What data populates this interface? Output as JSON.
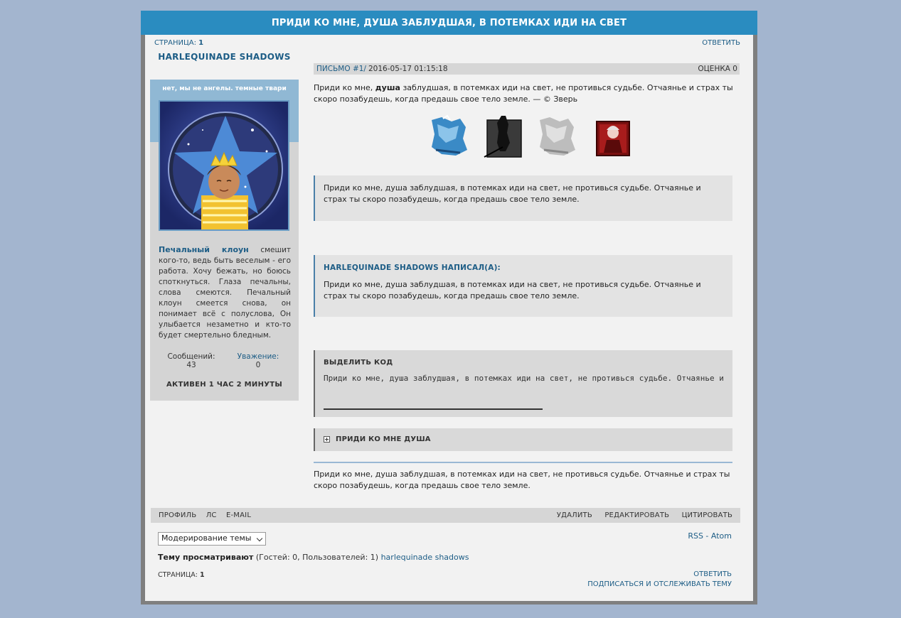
{
  "topic": {
    "title": "ПРИДИ КО МНЕ, ДУША ЗАБЛУДШАЯ, В ПОТЕМКАХ ИДИ НА СВЕТ"
  },
  "pagination": {
    "label": "СТРАНИЦА:",
    "current": "1"
  },
  "actions": {
    "reply": "ОТВЕТИТЬ",
    "subscribe": "ПОДПИСАТЬСЯ И ОТСЛЕЖИВАТЬ ТЕМУ"
  },
  "author": {
    "name": "HARLEQUINADE SHADOWS",
    "status": "нет, мы не ангелы. темные твари",
    "desc_bold": "Печальный клоун",
    "desc_rest": "смешит кого-то, ведь быть веселым - его работа. Хочу бежать, но боюсь споткнуться. Глаза печальны, слова смеются. Печальный клоун смеется снова, он понимает всё с полуслова, Он улыбается незаметно и кто-то будет смертельно бледным.",
    "messages_label": "Сообщений:",
    "messages_value": "43",
    "respect_label": "Уважение:",
    "respect_value": "0",
    "activity": "АКТИВЕН 1 ЧАС 2 МИНУТЫ"
  },
  "post": {
    "number": "ПИСЬМО #1/",
    "date": "2016-05-17 01:15:18",
    "rating": "ОЦЕНКА 0",
    "intro_a": "Приди ко мне, ",
    "intro_bold": "душа",
    "intro_b": " заблудшая, в потемках иди на свет, не противься судьбе. Отчаянье и страх ты скоро позабудешь, когда предашь свое тело земле. — © Зверь",
    "block_text": "Приди ко мне, душа заблудшая, в потемках иди на свет, не противься судьбе. Отчаянье и страх ты скоро позабудешь, когда предашь свое тело земле.",
    "quote_author": "HARLEQUINADE SHADOWS НАПИСАЛ(А):",
    "quote_text": "Приди ко мне, душа заблудшая, в потемках иди на свет, не противься судьбе. Отчаянье и страх ты скоро позабудешь, когда предашь свое тело земле.",
    "code_label": "ВЫДЕЛИТЬ КОД",
    "code_text": "Приди ко мне, душа заблудшая, в потемках иди на свет, не противься судьбе. Отчаянье и страх ты скоро позабудешь, когда предашь свое тело земле.",
    "spoiler_label": "ПРИДИ КО МНЕ ДУША",
    "outro": "Приди ко мне, душа заблудшая, в потемках иди на свет, не противься судьбе. Отчаянье и страх ты скоро позабудешь, когда предашь свое тело земле."
  },
  "post_footer": {
    "left": [
      "ПРОФИЛЬ",
      "ЛС",
      "E-MAIL"
    ],
    "right": [
      "УДАЛИТЬ",
      "РЕДАКТИРОВАТЬ",
      "ЦИТИРОВАТЬ"
    ]
  },
  "moderation": {
    "selected": "Модерирование темы"
  },
  "feeds": {
    "rss": "RSS",
    "sep": " - ",
    "atom": "Atom"
  },
  "viewers": {
    "label": "Тему просматривают",
    "counts": " (Гостей: 0, Пользователей: 1) ",
    "user": "harlequinade shadows"
  },
  "colors": {
    "title_bar": "#2a8cc0",
    "link": "#1d5d86",
    "background": "#a3b5cf"
  },
  "icons": [
    "spoiler-expand-icon",
    "select-chevron-icon"
  ]
}
